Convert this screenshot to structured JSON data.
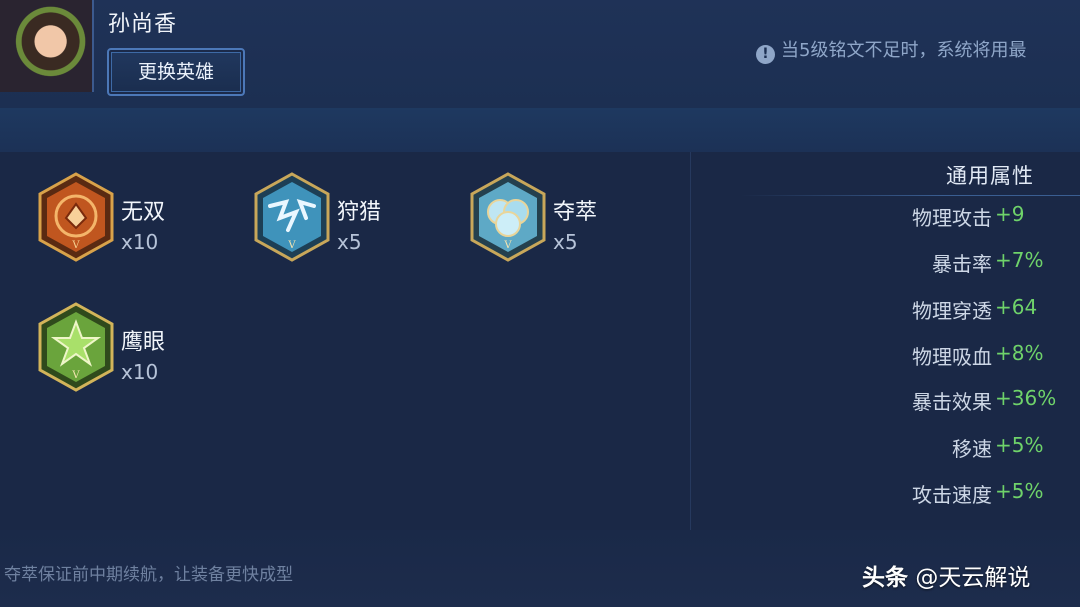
{
  "header": {
    "hero_name": "孙尚香",
    "change_hero_label": "更换英雄",
    "notice": "当5级铭文不足时，系统将用最"
  },
  "runes": [
    {
      "name": "无双",
      "count": "x10",
      "icon": "wushuang-rune-icon",
      "color": "#d2652a"
    },
    {
      "name": "狩猎",
      "count": "x5",
      "icon": "shoulie-rune-icon",
      "color": "#4fa3c8"
    },
    {
      "name": "夺萃",
      "count": "x5",
      "icon": "duocui-rune-icon",
      "color": "#6fb4cf"
    },
    {
      "name": "鹰眼",
      "count": "x10",
      "icon": "yingyan-rune-icon",
      "color": "#6aa43c"
    }
  ],
  "attributes": {
    "title": "通用属性",
    "items": [
      {
        "label": "物理攻击",
        "value": "+9"
      },
      {
        "label": "暴击率",
        "value": "+7%"
      },
      {
        "label": "物理穿透",
        "value": "+64"
      },
      {
        "label": "物理吸血",
        "value": "+8%"
      },
      {
        "label": "暴击效果",
        "value": "+36%"
      },
      {
        "label": "移速",
        "value": "+5%"
      },
      {
        "label": "攻击速度",
        "value": "+5%"
      }
    ]
  },
  "footer": {
    "tip": "夺萃保证前中期续航，让装备更快成型",
    "watermark_brand": "头条",
    "watermark_author": "@天云解说"
  },
  "colors": {
    "background": "#1b2a4a",
    "positive": "#6fd36a",
    "button_border": "#4c78b8"
  }
}
